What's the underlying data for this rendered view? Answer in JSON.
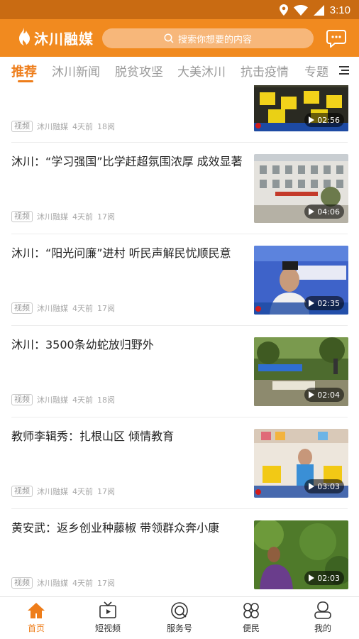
{
  "status_bar": {
    "time": "3:10"
  },
  "header": {
    "logo_text": "沐川融媒",
    "search_placeholder": "搜索你想要的内容"
  },
  "tabs": [
    {
      "label": "推荐",
      "active": true
    },
    {
      "label": "沐川新闻"
    },
    {
      "label": "脱贫攻坚"
    },
    {
      "label": "大美沐川"
    },
    {
      "label": "抗击疫情"
    },
    {
      "label": "专题"
    }
  ],
  "feed": [
    {
      "title": "",
      "badge": "视频",
      "source": "沐川融媒",
      "time": "4天前",
      "reads": "18阅",
      "duration": "02:56",
      "thumb_icon": "video-thumbnail-classroom"
    },
    {
      "title": "沐川：“学习强国”比学赶超氛围浓厚 成效显著",
      "badge": "视频",
      "source": "沐川融媒",
      "time": "4天前",
      "reads": "17阅",
      "duration": "04:06",
      "thumb_icon": "video-thumbnail-building"
    },
    {
      "title": "沐川：“阳光问廉”进村 听民声解民忧顺民意",
      "badge": "视频",
      "source": "沐川融媒",
      "time": "4天前",
      "reads": "17阅",
      "duration": "02:35",
      "thumb_icon": "video-thumbnail-speaker"
    },
    {
      "title": "沐川：3500条幼蛇放归野外",
      "badge": "视频",
      "source": "沐川融媒",
      "time": "4天前",
      "reads": "18阅",
      "duration": "02:04",
      "thumb_icon": "video-thumbnail-field"
    },
    {
      "title": "教师李辑秀：扎根山区 倾情教育",
      "badge": "视频",
      "source": "沐川融媒",
      "time": "4天前",
      "reads": "17阅",
      "duration": "03:03",
      "thumb_icon": "video-thumbnail-class"
    },
    {
      "title": "黄安武：返乡创业种藤椒 带领群众奔小康",
      "badge": "视频",
      "source": "沐川融媒",
      "time": "4天前",
      "reads": "17阅",
      "duration": "02:03",
      "thumb_icon": "video-thumbnail-farm"
    }
  ],
  "bottom_nav": [
    {
      "label": "首页",
      "icon": "home-icon",
      "active": true
    },
    {
      "label": "短视频",
      "icon": "tv-icon"
    },
    {
      "label": "服务号",
      "icon": "service-icon"
    },
    {
      "label": "便民",
      "icon": "clover-icon"
    },
    {
      "label": "我的",
      "icon": "profile-icon"
    }
  ],
  "colors": {
    "accent": "#ee7d1a",
    "header": "#f18a1f",
    "status_bar": "#c96b12"
  }
}
